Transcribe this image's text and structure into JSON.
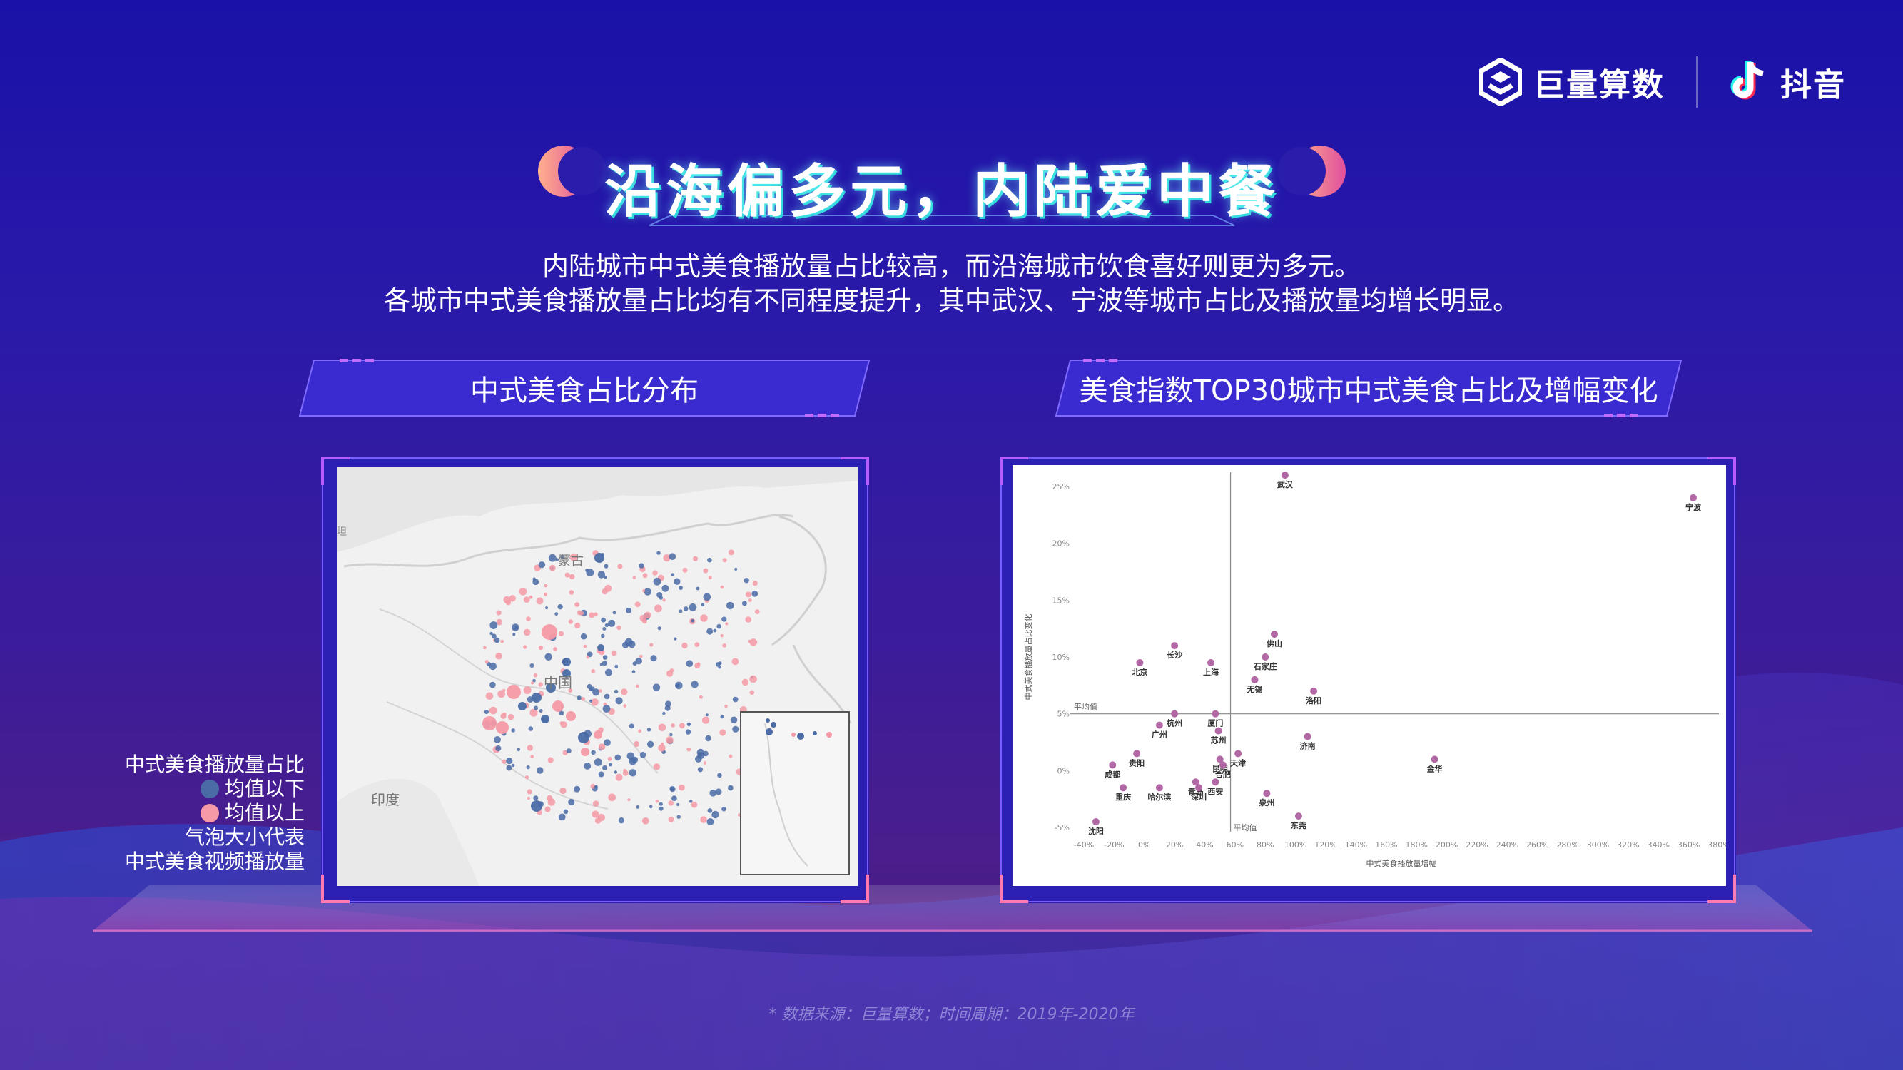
{
  "brand": {
    "left_name": "巨量算数",
    "right_name": "抖音"
  },
  "title": "沿海偏多元，内陆爱中餐",
  "subtitle": [
    "内陆城市中式美食播放量占比较高，而沿海城市饮食喜好则更为多元。",
    "各城市中式美食播放量占比均有不同程度提升，其中武汉、宁波等城市占比及播放量均增长明显。"
  ],
  "left_section_title": "中式美食占比分布",
  "right_section_title": "美食指数TOP30城市中式美食占比及增幅变化",
  "map": {
    "labels": {
      "mongolia": "蒙古",
      "china": "中国",
      "india": "印度",
      "edge": "坦"
    },
    "colors": {
      "below": "#4a6ba6",
      "above": "#f59aa6"
    }
  },
  "legend": {
    "title": "中式美食播放量占比",
    "below": "均值以下",
    "above": "均值以上",
    "note1": "气泡大小代表",
    "note2": "中式美食视频播放量"
  },
  "chart_data": {
    "type": "scatter",
    "xlabel": "中式美食播放量增幅",
    "ylabel": "中式美食播放量占比变化",
    "xlim": [
      -40,
      380
    ],
    "ylim": [
      -5,
      25
    ],
    "x_ticks": [
      "-40%",
      "-20%",
      "0%",
      "20%",
      "40%",
      "60%",
      "80%",
      "100%",
      "120%",
      "140%",
      "160%",
      "180%",
      "200%",
      "220%",
      "240%",
      "260%",
      "280%",
      "300%",
      "320%",
      "340%",
      "360%",
      "380%"
    ],
    "x_tick_values": [
      -40,
      -20,
      0,
      20,
      40,
      60,
      80,
      100,
      120,
      140,
      160,
      180,
      200,
      220,
      240,
      260,
      280,
      300,
      320,
      340,
      360,
      380
    ],
    "y_ticks": [
      "-5%",
      "0%",
      "5%",
      "10%",
      "15%",
      "20%",
      "25%"
    ],
    "y_tick_values": [
      -5,
      0,
      5,
      10,
      15,
      20,
      25
    ],
    "avg_x": 57,
    "avg_y": 5,
    "avg_label_x": "平均值",
    "avg_label_y": "平均值",
    "point_color": "#b368a6",
    "points": [
      {
        "name": "武汉",
        "x": 93,
        "y": 26
      },
      {
        "name": "宁波",
        "x": 363,
        "y": 24
      },
      {
        "name": "北京",
        "x": -3,
        "y": 9.5
      },
      {
        "name": "长沙",
        "x": 20,
        "y": 11
      },
      {
        "name": "上海",
        "x": 44,
        "y": 9.5
      },
      {
        "name": "佛山",
        "x": 86,
        "y": 12
      },
      {
        "name": "石家庄",
        "x": 80,
        "y": 10
      },
      {
        "name": "无锡",
        "x": 73,
        "y": 8
      },
      {
        "name": "洛阳",
        "x": 112,
        "y": 7
      },
      {
        "name": "厦门",
        "x": 47,
        "y": 5
      },
      {
        "name": "杭州",
        "x": 20,
        "y": 5
      },
      {
        "name": "广州",
        "x": 10,
        "y": 4
      },
      {
        "name": "苏州",
        "x": 49,
        "y": 3.5
      },
      {
        "name": "济南",
        "x": 108,
        "y": 3
      },
      {
        "name": "贵阳",
        "x": -5,
        "y": 1.5
      },
      {
        "name": "天津",
        "x": 62,
        "y": 1.5
      },
      {
        "name": "昆明",
        "x": 50,
        "y": 1
      },
      {
        "name": "合肥",
        "x": 52,
        "y": 0.5
      },
      {
        "name": "金华",
        "x": 192,
        "y": 1
      },
      {
        "name": "成都",
        "x": -21,
        "y": 0.5
      },
      {
        "name": "青岛",
        "x": 34,
        "y": -1
      },
      {
        "name": "深圳",
        "x": 36,
        "y": -1.5
      },
      {
        "name": "西安",
        "x": 47,
        "y": -1
      },
      {
        "name": "重庆",
        "x": -14,
        "y": -1.5
      },
      {
        "name": "哈尔滨",
        "x": 10,
        "y": -1.5
      },
      {
        "name": "泉州",
        "x": 81,
        "y": -2
      },
      {
        "name": "东莞",
        "x": 102,
        "y": -4
      },
      {
        "name": "沈阳",
        "x": -32,
        "y": -4.5
      }
    ]
  },
  "footer": "* 数据来源：巨量算数；时间周期：2019年-2020年"
}
